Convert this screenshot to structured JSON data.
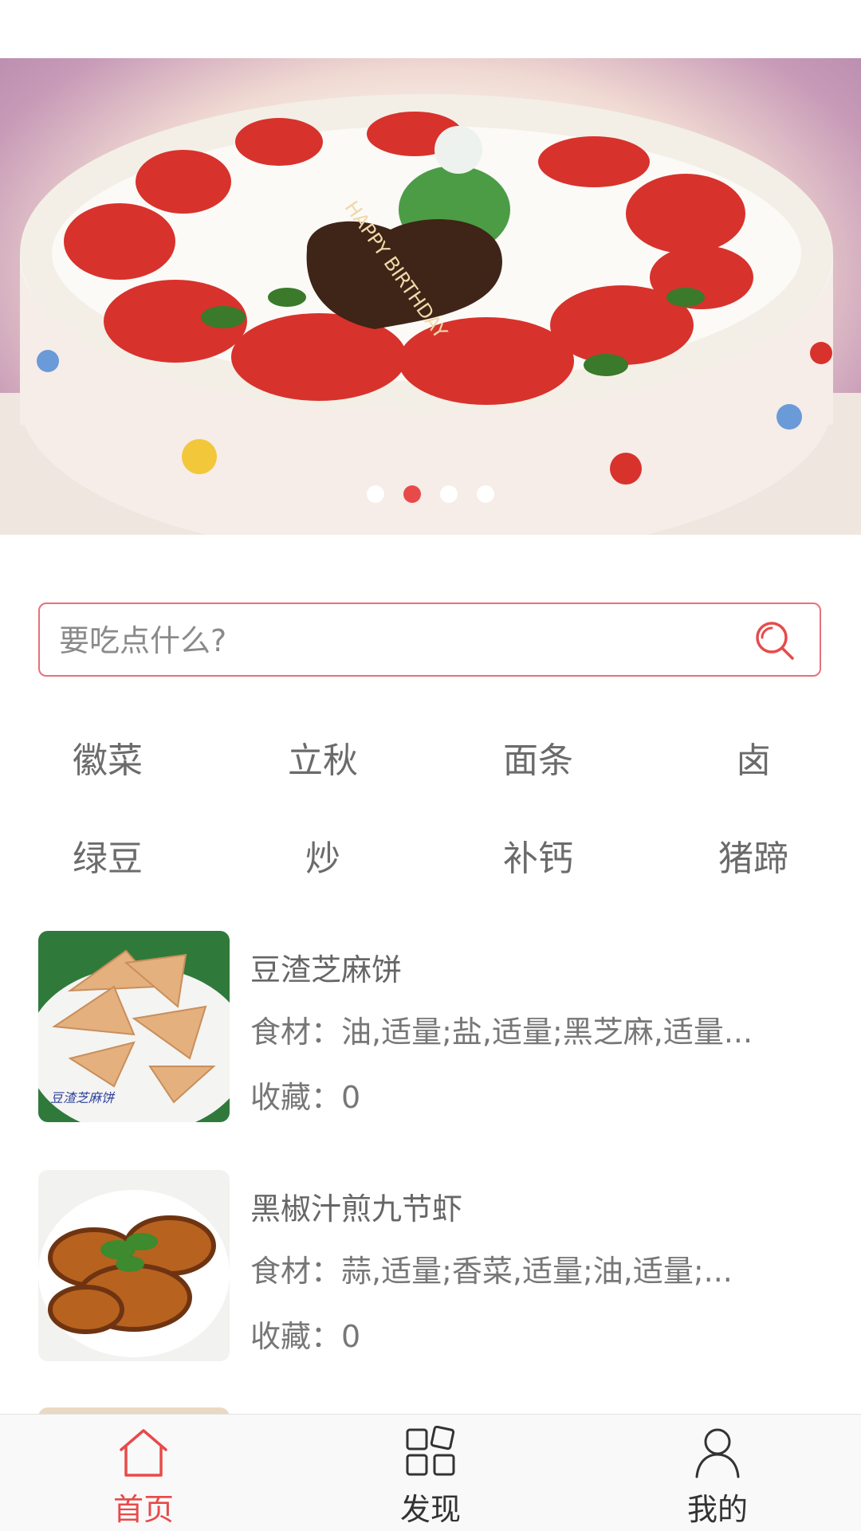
{
  "banner": {
    "cake_plaque_text": "HAPPY BIRTHDAY",
    "dots": 4,
    "active_dot": 1
  },
  "search": {
    "placeholder": "要吃点什么?"
  },
  "categories": [
    "徽菜",
    "立秋",
    "面条",
    "卤",
    "绿豆",
    "炒",
    "补钙",
    "猪蹄"
  ],
  "recipes": [
    {
      "title": "豆渣芝麻饼",
      "ingredients": "食材：油,适量;盐,适量;黑芝麻,适量...",
      "favorites": "收藏：0",
      "thumb_caption": "豆渣芝麻饼"
    },
    {
      "title": "黑椒汁煎九节虾",
      "ingredients": "食材：蒜,适量;香菜,适量;油,适量;...",
      "favorites": "收藏：0"
    }
  ],
  "nav": {
    "home": "首页",
    "discover": "发现",
    "mine": "我的"
  },
  "colors": {
    "accent": "#e84a4a",
    "search_border": "#e8707a",
    "text_gray": "#666666",
    "nav_bg": "#f9f9f9"
  }
}
